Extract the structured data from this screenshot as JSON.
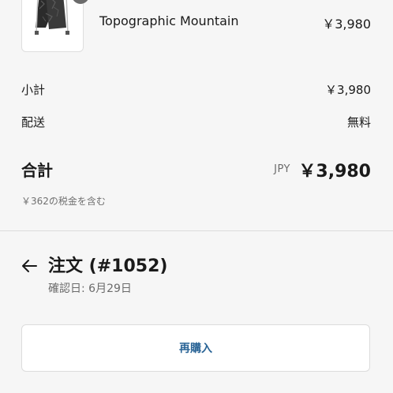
{
  "line_item": {
    "product_name": "Topographic Mountain",
    "price": "￥3,980"
  },
  "summary": {
    "subtotal_label": "小計",
    "subtotal_value": "￥3,980",
    "shipping_label": "配送",
    "shipping_value": "無料",
    "total_label": "合計",
    "currency": "JPY",
    "total_value": "￥3,980",
    "tax_note": "￥362の税金を含む"
  },
  "order": {
    "title": "注文 (#1052)",
    "confirmed_date": "確認日: 6月29日"
  },
  "actions": {
    "reorder_label": "再購入"
  },
  "colors": {
    "link": "#2a6496",
    "muted_text": "#6b6b6b",
    "background": "#f6f6f6"
  },
  "icons": {
    "back": "arrow-left-icon",
    "thumbnail": "drawstring-bag-product-image"
  }
}
